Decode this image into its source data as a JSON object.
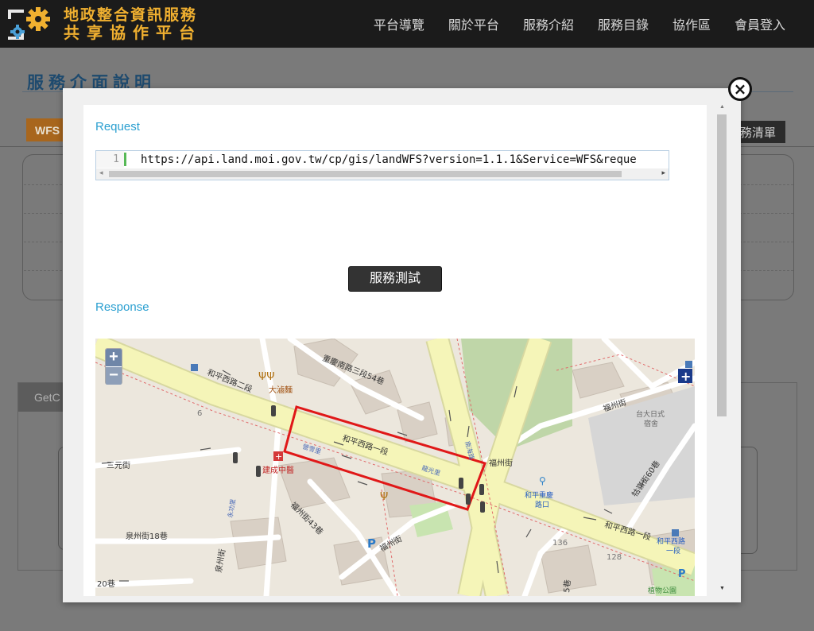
{
  "header": {
    "logo_line1": "地政整合資訊服務",
    "logo_line2": "共享協作平台",
    "nav": [
      "平台導覽",
      "關於平台",
      "服務介紹",
      "服務目錄",
      "協作區",
      "會員登入"
    ]
  },
  "background": {
    "page_title": "服務介面說明",
    "tab_wfs": "WFS",
    "tab_list": "務清單",
    "panel_head": "GetC"
  },
  "modal": {
    "close_symbol": "×",
    "request_label": "Request",
    "line_number": "1",
    "request_url": "https://api.land.moi.gov.tw/cp/gis/landWFS?version=1.1.1&Service=WFS&reque",
    "test_button": "服務測試",
    "response_label": "Response"
  },
  "map": {
    "zoom_in": "+",
    "zoom_out": "−",
    "labels": {
      "road_heping2": "和平西路二段",
      "road_heping1_center": "和平西路一段",
      "road_heping1_right": "和平西路一段",
      "chongqing": "重慶南路三段54巷",
      "fuzhou_top": "福州街",
      "fuzhou_mid": "福州街",
      "fuzhou_bottom": "福州街",
      "fuzhou43": "福州街43巷",
      "sanyuan": "三元街",
      "quanzhou18": "泉州街18巷",
      "quanzhou": "泉州街",
      "daren": "大滷麵",
      "jiancheng": "建成中醫",
      "taida": "台大日式",
      "taida2": "宿舍",
      "heping_chongqing": "和平重慶",
      "heping_chongqing2": "路口",
      "gulun60": "牯嶺街60巷",
      "yingxue": "營雪里",
      "longguang": "龍光里",
      "aiguo": "南海路",
      "yongchang": "永功里",
      "num_6": "6",
      "num_136": "136",
      "num_128": "128",
      "lane_20": "20巷",
      "lane_5": "5巷",
      "heping_bus": "和平西路",
      "heping_bus2": "一段",
      "park": "植物公園",
      "parking": "P"
    }
  },
  "colors": {
    "accent": "#2a9fd0",
    "logo": "#f0b030",
    "highlight_box": "#e01818",
    "major_road": "#f5f5b8"
  }
}
